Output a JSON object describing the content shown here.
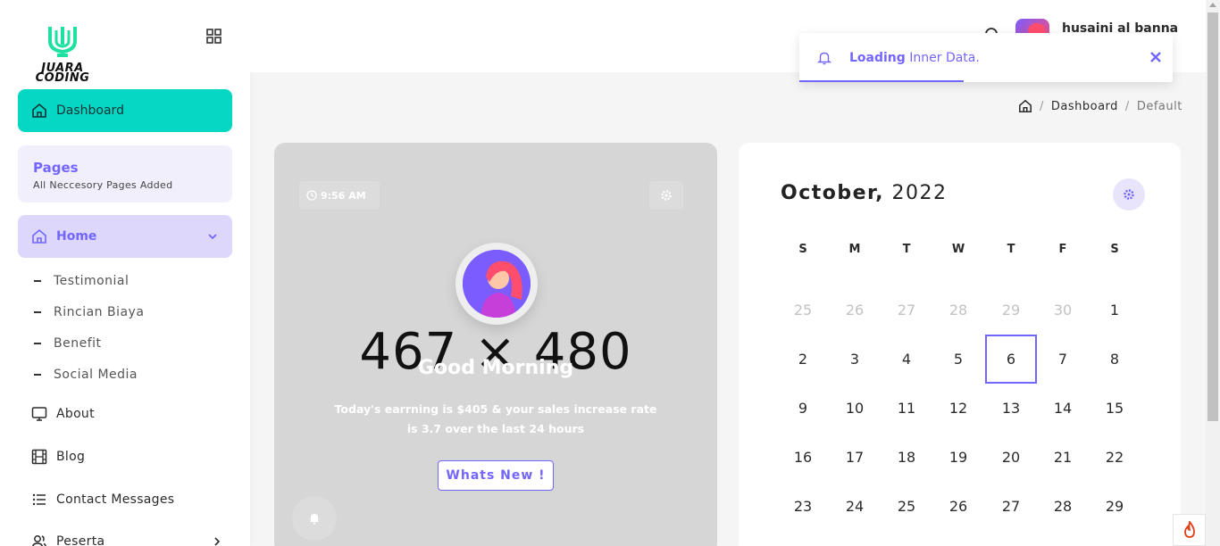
{
  "app": {
    "logo_text_line1": "JUARA",
    "logo_text_line2": "CODING"
  },
  "sidebar": {
    "dashboard_label": "Dashboard",
    "pages_title": "Pages",
    "pages_subtitle": "All Neccesory Pages Added",
    "home_label": "Home",
    "home_subitems": [
      "Testimonial",
      "Rincian Biaya",
      "Benefit",
      "Social Media"
    ],
    "items": [
      {
        "label": "About",
        "icon": "monitor-icon"
      },
      {
        "label": "Blog",
        "icon": "film-icon"
      },
      {
        "label": "Contact Messages",
        "icon": "list-icon"
      },
      {
        "label": "Peserta",
        "icon": "users-icon"
      }
    ]
  },
  "header": {
    "username": "husaini al banna"
  },
  "toast": {
    "bold": "Loading",
    "text": " Inner Data.",
    "close": "✕",
    "progress_fraction": 0.44
  },
  "breadcrumb": {
    "items": [
      "Dashboard",
      "Default"
    ]
  },
  "greeting": {
    "time": "9:56 AM",
    "placeholder": "467 × 480",
    "title": "Good Morning",
    "earning_line1": "Today's earrning is $405 & your sales increase rate",
    "earning_line2": "is 3.7 over the last 24 hours",
    "button": "Whats New !"
  },
  "calendar": {
    "month": "October,",
    "year": " 2022",
    "weekdays": [
      "S",
      "M",
      "T",
      "W",
      "T",
      "F",
      "S"
    ],
    "weeks": [
      [
        {
          "d": "25",
          "m": true
        },
        {
          "d": "26",
          "m": true
        },
        {
          "d": "27",
          "m": true
        },
        {
          "d": "28",
          "m": true
        },
        {
          "d": "29",
          "m": true
        },
        {
          "d": "30",
          "m": true
        },
        {
          "d": "1"
        }
      ],
      [
        {
          "d": "2"
        },
        {
          "d": "3"
        },
        {
          "d": "4"
        },
        {
          "d": "5"
        },
        {
          "d": "6",
          "sel": true
        },
        {
          "d": "7"
        },
        {
          "d": "8"
        }
      ],
      [
        {
          "d": "9"
        },
        {
          "d": "10"
        },
        {
          "d": "11"
        },
        {
          "d": "12"
        },
        {
          "d": "13"
        },
        {
          "d": "14"
        },
        {
          "d": "15"
        }
      ],
      [
        {
          "d": "16"
        },
        {
          "d": "17"
        },
        {
          "d": "18"
        },
        {
          "d": "19"
        },
        {
          "d": "20"
        },
        {
          "d": "21"
        },
        {
          "d": "22"
        }
      ],
      [
        {
          "d": "23"
        },
        {
          "d": "24"
        },
        {
          "d": "25"
        },
        {
          "d": "26"
        },
        {
          "d": "27"
        },
        {
          "d": "28"
        },
        {
          "d": "29"
        }
      ]
    ]
  },
  "colors": {
    "accent": "#7366ff",
    "teal": "#06d6c4"
  }
}
